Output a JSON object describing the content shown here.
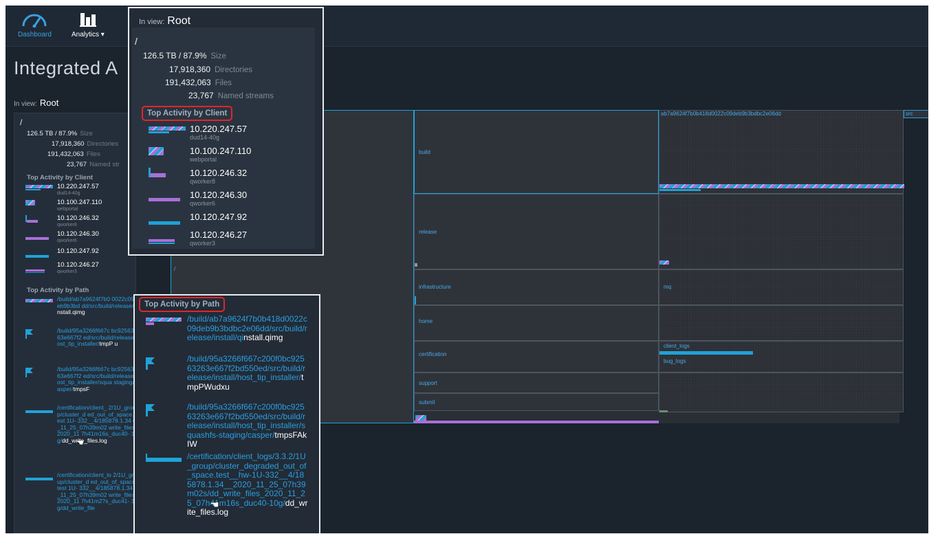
{
  "nav": {
    "dashboard_label": "Dashboard",
    "analytics_label": "Analytics ▾"
  },
  "page": {
    "title": "Integrated A"
  },
  "in_view": {
    "label": "In view:",
    "value": "Root"
  },
  "summary": {
    "path": "/",
    "size": "126.5 TB / 87.9%",
    "size_label": "Size",
    "directories": "17,918,360",
    "directories_label": "Directories",
    "files": "191,432,063",
    "files_label": "Files",
    "streams": "23,767",
    "streams_label": "Named streams",
    "streams_label_short": "Named str"
  },
  "clients_heading": "Top Activity by Client",
  "clients": [
    {
      "ip": "10.220.247.57",
      "host": "dud14-40g"
    },
    {
      "ip": "10.100.247.110",
      "host": "webportal"
    },
    {
      "ip": "10.120.246.32",
      "host": "qworker8"
    },
    {
      "ip": "10.120.246.30",
      "host": "qworker6"
    },
    {
      "ip": "10.120.247.92",
      "host": ""
    },
    {
      "ip": "10.120.246.27",
      "host": "qworker3"
    }
  ],
  "paths_heading": "Top Activity by Path",
  "paths": [
    {
      "link": "/build/ab7a9624f7b0b418d0022c09deb9b3bdbc2e06dd/src/build/release/install/qi",
      "end": "nstall.qimg"
    },
    {
      "link": "/build/95a3266f667c200f0bc92563263e667f2bd550ed/src/build/release/install/host_tip_installer/",
      "end": "tmpPWudxu"
    },
    {
      "link": "/build/95a3266f667c200f0bc92563263e667f2bd550ed/src/build/release/install/host_tip_installer/squashfs-staging/casper/",
      "end": "tmpsFAkIW"
    },
    {
      "link": "/certification/client_logs/3.3.2/1U_group/cluster_degraded_out_of_space.test__hw-1U-332__4/185878.1.34__2020_11_25_07h39m02s/dd_write_files_2020_11_25_07h41m16s_duc40-10g/",
      "end": "dd_write_files.log"
    },
    {
      "link": "/certification/client_logs/3.3.2/1U_group/cluster_degraded_out_of_space.test__hw-1U-332__4/185878.1.34__2020_11_25_07h39m02s/dd_write_files_2020_11_25_07h41m2?s_duc41-10",
      "end": ""
    }
  ],
  "small_paths_display": [
    {
      "link": "/build/ab7a9624f7b0 0022c09deb9b3bd dd/src/build/release/i",
      "end": "nstall.qimg"
    },
    {
      "link": "/build/95a3266f667c bc92563263e667f2 ed/src/build/release/ ost_tip_installer/",
      "end": "tmpP u"
    },
    {
      "link": "/build/95a3266f667c bc92563263e667f2 ed/src/build/release/ ost_tip_installer/squa staging/casper/",
      "end": "tmpsF"
    },
    {
      "link": "/certification/client_ 2/1U_group/cluster_d ed_out_of_space.test 1U- 332__4/185878.1.34 0_11_25_07h39m02 write_files_2020_11 7h41m16s_duc40- 10g/",
      "end": "dd_write_files.log"
    },
    {
      "link": "/certification/client_lo 2/1U_group/cluster_d ed_out_of_space.test 1U- 332__4/185878.1.34 0_11_25_07h39m02 write_files_2020_11 7h41m2?s_duc41- 10g/dd_write_file",
      "end": ""
    }
  ],
  "treemap": {
    "root_label": "/",
    "dirs": [
      "build",
      "release",
      "infrastructure",
      "home",
      "certification",
      "support",
      "submit"
    ],
    "hash_label": "ab7a9624f7b0b418d0022c09deb9b3bdbc2e06dd",
    "src_label": "src",
    "mq_label": "mq",
    "client_logs_label": "client_logs",
    "bug_logs_label": "bug_logs"
  },
  "colors": {
    "read": "#1fa2d8",
    "write": "#a870d8",
    "link": "#2b9ee0",
    "highlight": "#e0262c"
  }
}
